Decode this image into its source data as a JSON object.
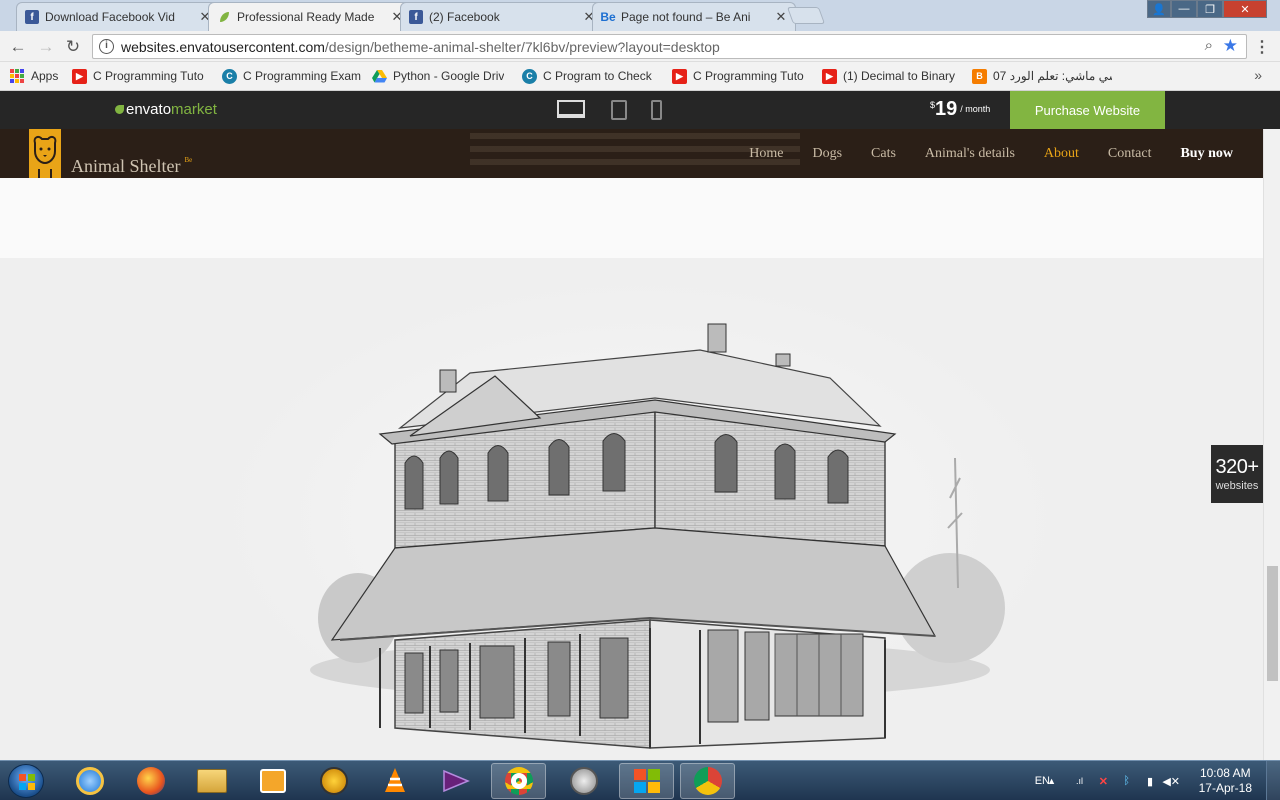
{
  "browser": {
    "tabs": [
      {
        "title": "Download Facebook Vid",
        "icon": "facebook-icon",
        "active": false
      },
      {
        "title": "Professional Ready Made",
        "icon": "envato-leaf-icon",
        "active": true
      },
      {
        "title": "(2) Facebook",
        "icon": "facebook-icon",
        "active": false
      },
      {
        "title": "Page not found – Be Ani",
        "icon": "betheme-icon",
        "active": false
      }
    ],
    "url_prefix": "websites.envatousercontent.com",
    "url_path": "/design/betheme-animal-shelter/7kl6bv/preview?layout=desktop",
    "bookmarks": [
      {
        "label": "Apps",
        "icon": "apps-grid-icon"
      },
      {
        "label": "C Programming Tuto",
        "icon": "youtube-icon"
      },
      {
        "label": "C Programming Exam",
        "icon": "c-site-icon"
      },
      {
        "label": "Python - Google Driv",
        "icon": "google-drive-icon"
      },
      {
        "label": "C Program to Check",
        "icon": "c-site-icon"
      },
      {
        "label": "C Programming Tuto",
        "icon": "youtube-icon"
      },
      {
        "label": "(1) Decimal to Binary",
        "icon": "youtube-icon"
      },
      {
        "label": "كل شي ماشي: تعلم الورد 07",
        "icon": "blogger-icon"
      }
    ]
  },
  "envato": {
    "logo_main": "envato",
    "logo_accent": "market",
    "price_currency": "$",
    "price_amount": "19",
    "price_period": "/ month",
    "purchase_label": "Purchase Website"
  },
  "site": {
    "name": "Animal Shelter",
    "name_badge": "Be",
    "nav": [
      {
        "label": "Home",
        "state": "normal"
      },
      {
        "label": "Dogs",
        "state": "normal"
      },
      {
        "label": "Cats",
        "state": "normal"
      },
      {
        "label": "Animal's details",
        "state": "normal"
      },
      {
        "label": "About",
        "state": "active"
      },
      {
        "label": "Contact",
        "state": "normal"
      },
      {
        "label": "Buy now",
        "state": "highlight"
      }
    ],
    "badge_count": "320+",
    "badge_label": "websites"
  },
  "taskbar": {
    "language": "EN",
    "time": "10:08 AM",
    "date": "17-Apr-18"
  },
  "colors": {
    "accent_orange": "#e9a417",
    "envato_green": "#82b541",
    "header_brown": "#2b1f17"
  }
}
